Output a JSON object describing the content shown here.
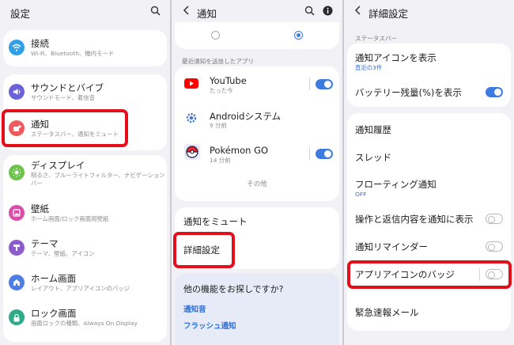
{
  "settings": {
    "title": "設定",
    "items": [
      {
        "title": "接続",
        "subtitle": "Wi-Fi、Bluetooth、機内モード",
        "icon": "wifi-icon",
        "color": "#2f9fe8"
      },
      {
        "title": "サウンドとバイブ",
        "subtitle": "サウンドモード、着信音",
        "icon": "speaker-icon",
        "color": "#6b63d9"
      },
      {
        "title": "通知",
        "subtitle": "ステータスバー、通知をミュート",
        "icon": "notification-icon",
        "color": "#ef5a5f"
      },
      {
        "title": "ディスプレイ",
        "subtitle": "明るさ、ブルーライトフィルター、ナビゲーションバー",
        "icon": "display-icon",
        "color": "#6cc24a"
      },
      {
        "title": "壁紙",
        "subtitle": "ホーム画面/ロック画面用壁紙",
        "icon": "wallpaper-icon",
        "color": "#d84fa9"
      },
      {
        "title": "テーマ",
        "subtitle": "テーマ、壁紙、アイコン",
        "icon": "theme-icon",
        "color": "#8c5ccb"
      },
      {
        "title": "ホーム画面",
        "subtitle": "レイアウト、アプリアイコンのバッジ",
        "icon": "home-icon",
        "color": "#4d7ee6"
      },
      {
        "title": "ロック画面",
        "subtitle": "画面ロックの種類、Always On Display",
        "icon": "lock-icon",
        "color": "#2faa8a"
      }
    ]
  },
  "notifications": {
    "title": "通知",
    "recent_label": "最近通知を送信したアプリ",
    "apps": [
      {
        "name": "YouTube",
        "time": "たった今",
        "toggle": true,
        "icon": "youtube-icon"
      },
      {
        "name": "Androidシステム",
        "time": "9 分前",
        "toggle": null,
        "icon": "android-gear-icon"
      },
      {
        "name": "Pokémon GO",
        "time": "14 分前",
        "toggle": true,
        "icon": "pokeball-icon"
      }
    ],
    "more": "その他",
    "mute": "通知をミュート",
    "advanced": "詳細設定",
    "looking_for": "他の機能をお探しですか?",
    "links": [
      "通知音",
      "フラッシュ通知"
    ]
  },
  "advanced": {
    "title": "詳細設定",
    "status_bar_label": "ステータスバー",
    "notif_icons": {
      "title": "通知アイコンを表示",
      "sub": "直近の3件"
    },
    "battery": {
      "title": "バッテリー残量(%)を表示",
      "toggle": true
    },
    "history": "通知履歴",
    "threads": "スレッド",
    "floating": {
      "title": "フローティング通知",
      "sub": "OFF"
    },
    "show_actions": {
      "title": "操作と返信内容を通知に表示",
      "toggle": false
    },
    "reminder": {
      "title": "通知リマインダー",
      "toggle": false
    },
    "badges": {
      "title": "アプリアイコンのバッジ",
      "toggle": false
    },
    "emergency": "緊急速報メール"
  },
  "colors": {
    "accent": "#3e7be0",
    "highlight": "#e3101c"
  }
}
